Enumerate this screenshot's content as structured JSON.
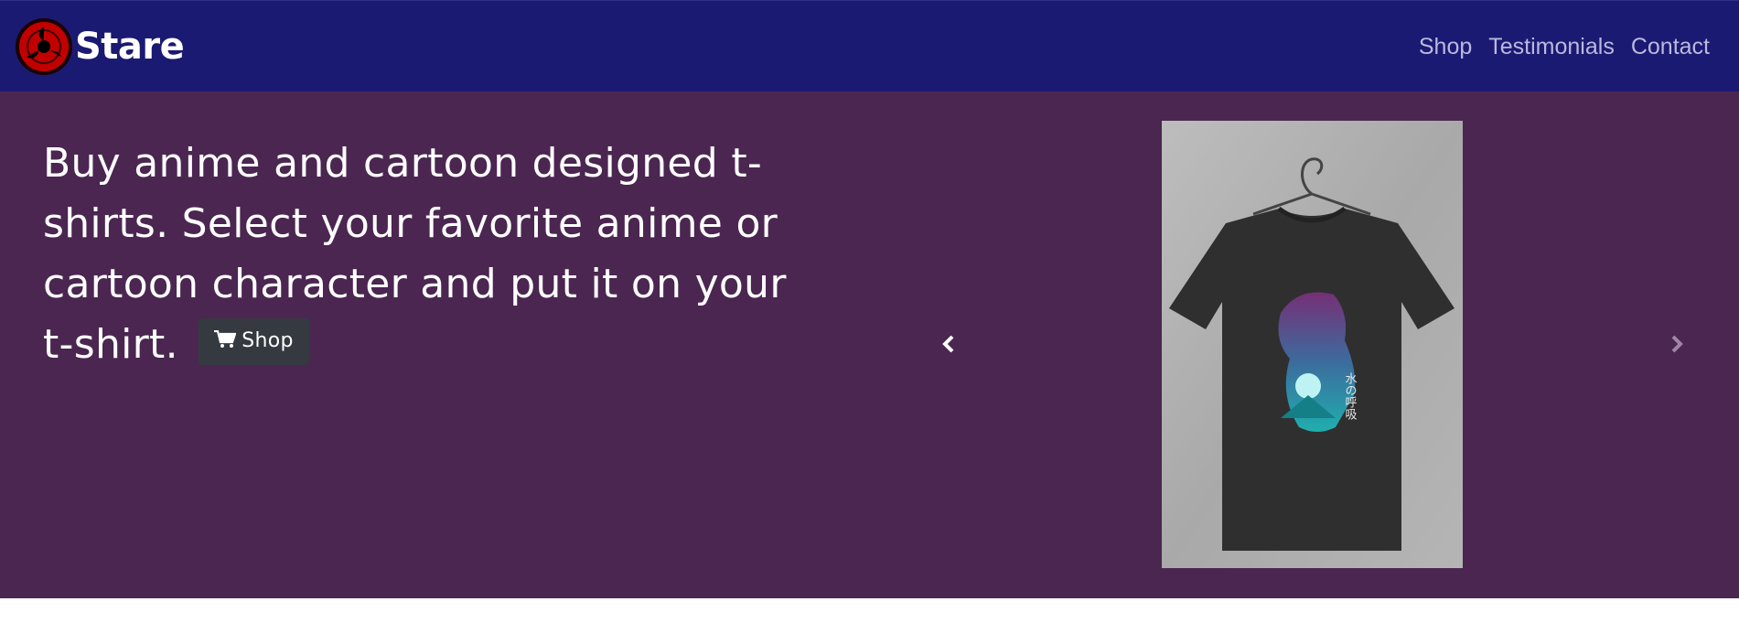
{
  "brand": {
    "name": "Stare",
    "logo_icon": "sharingan-logo-icon",
    "logo_colors": {
      "outer": "#1a0000",
      "ring": "#b30000",
      "core": "#000000"
    }
  },
  "nav": {
    "links": [
      {
        "label": "Shop"
      },
      {
        "label": "Testimonials"
      },
      {
        "label": "Contact"
      }
    ]
  },
  "hero": {
    "text": "Buy anime and cartoon designed t-shirts. Select your favorite anime or cartoon character and put it on your t-shirt.",
    "shop_button": {
      "label": "Shop",
      "icon": "shopping-cart-icon"
    },
    "background_color": "#4b2651"
  },
  "carousel": {
    "prev_icon": "chevron-left-icon",
    "next_icon": "chevron-right-icon",
    "image": {
      "subject": "t-shirt-product-image",
      "print_text": "水の呼吸"
    }
  },
  "colors": {
    "navbar": "#1a1a72",
    "nav_link": "#b9b9e0",
    "button": "#343a40"
  }
}
